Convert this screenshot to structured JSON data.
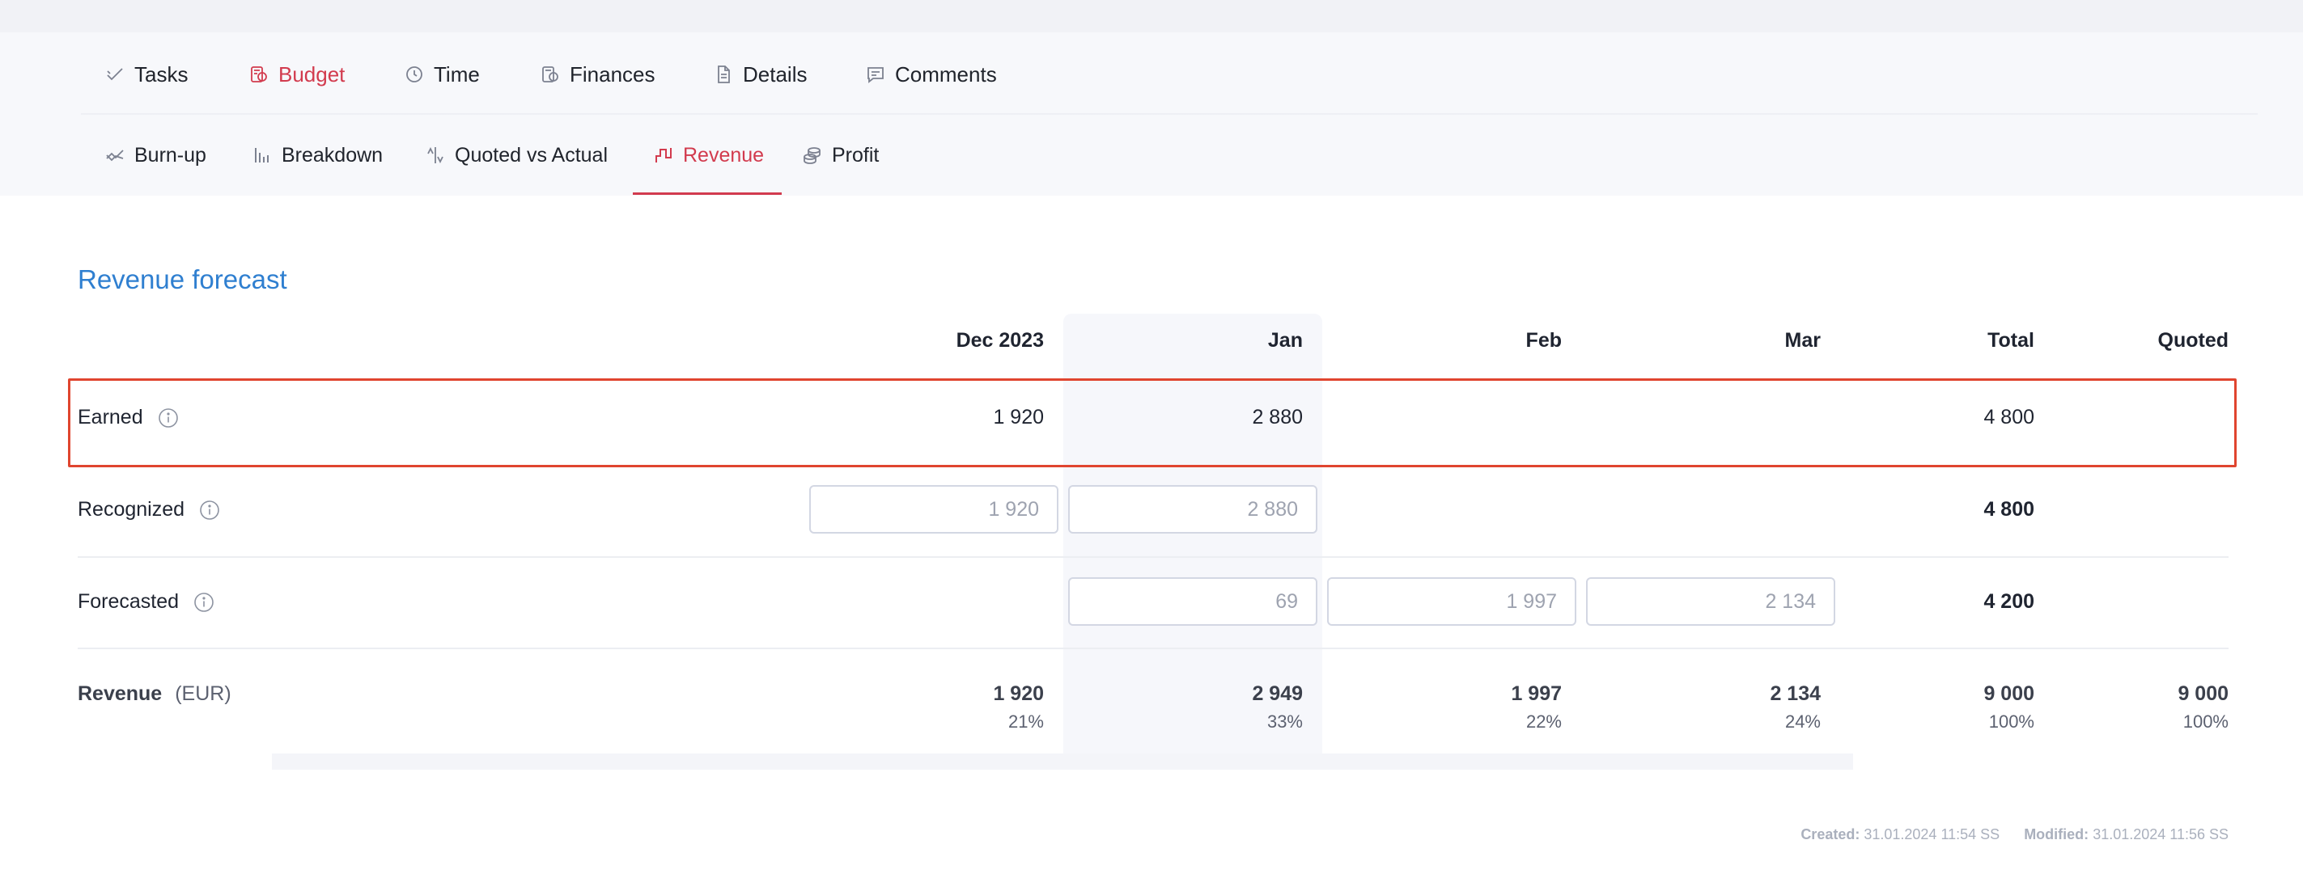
{
  "tabs": [
    {
      "label": "Tasks",
      "icon": "check-icon",
      "active": false
    },
    {
      "label": "Budget",
      "icon": "budget-icon",
      "active": true
    },
    {
      "label": "Time",
      "icon": "clock-icon",
      "active": false
    },
    {
      "label": "Finances",
      "icon": "finances-icon",
      "active": false
    },
    {
      "label": "Details",
      "icon": "document-icon",
      "active": false
    },
    {
      "label": "Comments",
      "icon": "comment-icon",
      "active": false
    }
  ],
  "subtabs": [
    {
      "label": "Burn-up",
      "icon": "burnup-icon",
      "active": false
    },
    {
      "label": "Breakdown",
      "icon": "bar-chart-icon",
      "active": false
    },
    {
      "label": "Quoted vs Actual",
      "icon": "compare-icon",
      "active": false
    },
    {
      "label": "Revenue",
      "icon": "revenue-icon",
      "active": true
    },
    {
      "label": "Profit",
      "icon": "coins-icon",
      "active": false
    }
  ],
  "section_title": "Revenue forecast",
  "columns": [
    "Dec 2023",
    "Jan",
    "Feb",
    "Mar",
    "Total",
    "Quoted"
  ],
  "rows": {
    "earned": {
      "label": "Earned",
      "dec": "1 920",
      "jan": "2 880",
      "total": "4 800"
    },
    "recognized": {
      "label": "Recognized",
      "dec": "1 920",
      "jan": "2 880",
      "total": "4 800"
    },
    "forecasted": {
      "label": "Forecasted",
      "jan": "69",
      "feb": "1 997",
      "mar": "2 134",
      "total": "4 200"
    },
    "revenue": {
      "label": "Revenue",
      "unit": "(EUR)",
      "dec": "1 920",
      "dec_pct": "21%",
      "jan": "2 949",
      "jan_pct": "33%",
      "feb": "1 997",
      "feb_pct": "22%",
      "mar": "2 134",
      "mar_pct": "24%",
      "total": "9 000",
      "total_pct": "100%",
      "quoted": "9 000",
      "quoted_pct": "100%"
    }
  },
  "footer": {
    "created_label": "Created:",
    "created_value": "31.01.2024 11:54 SS",
    "modified_label": "Modified:",
    "modified_value": "31.01.2024 11:56 SS"
  },
  "colors": {
    "accent": "#d23b4e",
    "title": "#2f7fd0",
    "highlight": "#e0452f"
  }
}
